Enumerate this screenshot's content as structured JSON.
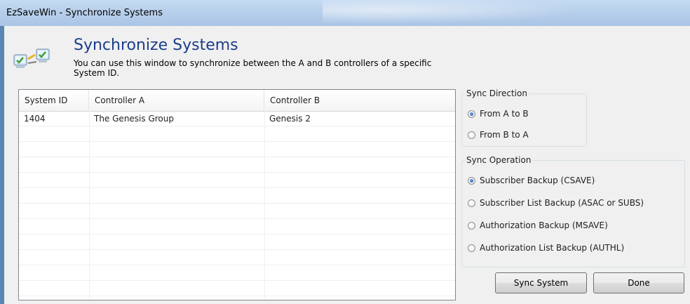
{
  "window": {
    "title": "EzSaveWin - Synchronize Systems"
  },
  "header": {
    "icon": "sync-computers-icon",
    "title": "Synchronize Systems",
    "description": "You can use this window to synchronize between the A and B controllers of a specific System ID."
  },
  "grid": {
    "columns": [
      "System ID",
      "Controller A",
      "Controller B"
    ],
    "rows": [
      {
        "system_id": "1404",
        "controller_a": "The Genesis Group",
        "controller_b": "Genesis 2"
      }
    ]
  },
  "sync_direction": {
    "legend": "Sync Direction",
    "options": [
      {
        "label": "From A to B",
        "selected": true
      },
      {
        "label": "From B to A",
        "selected": false
      }
    ]
  },
  "sync_operation": {
    "legend": "Sync Operation",
    "options": [
      {
        "label": "Subscriber Backup (CSAVE)",
        "selected": true
      },
      {
        "label": "Subscriber List Backup (ASAC or SUBS)",
        "selected": false
      },
      {
        "label": "Authorization Backup (MSAVE)",
        "selected": false
      },
      {
        "label": "Authorization List Backup (AUTHL)",
        "selected": false
      }
    ]
  },
  "buttons": {
    "sync_system": "Sync System",
    "done": "Done"
  },
  "colors": {
    "title_text": "#1b3d8a",
    "window_border": "#5a86b6",
    "client_bg": "#f0f0f0"
  }
}
